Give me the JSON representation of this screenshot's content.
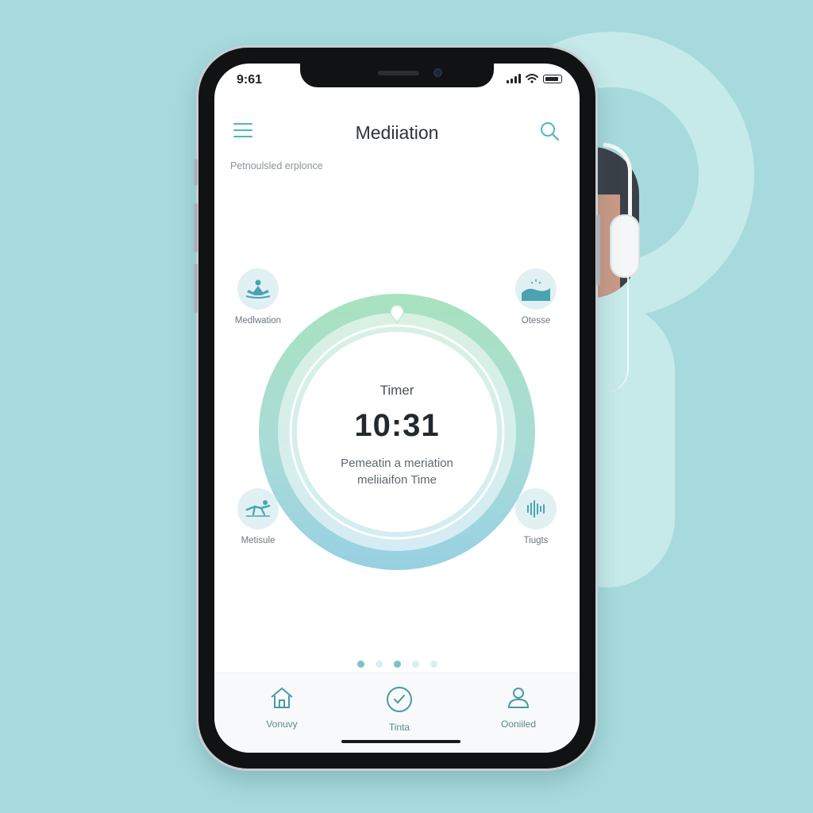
{
  "status_bar": {
    "time": "9:61"
  },
  "header": {
    "title": "Mediiation"
  },
  "subtitle": "Petnoulsled erplonce",
  "features": {
    "top_left": {
      "label": "Medlwation",
      "icon": "meditation-lotus-icon"
    },
    "top_right": {
      "label": "Otesse",
      "icon": "ocean-wave-icon"
    },
    "bottom_left": {
      "label": "Metisule",
      "icon": "stretch-pose-icon"
    },
    "bottom_right": {
      "label": "Tiugts",
      "icon": "sound-wave-icon"
    }
  },
  "timer": {
    "label": "Timer",
    "value": "10:31",
    "desc_line1": "Pemeatin a meriation",
    "desc_line2": "meliiaifon Time"
  },
  "pager": {
    "count": 5,
    "active": [
      0,
      2
    ]
  },
  "tabbar": {
    "tabs": [
      {
        "label": "Vonuvy",
        "icon": "home-icon"
      },
      {
        "label": "Tinta",
        "icon": "clock-icon"
      },
      {
        "label": "Ooniiled",
        "icon": "user-icon"
      }
    ]
  },
  "colors": {
    "background": "#a6dadc",
    "accent": "#4bb8b8",
    "ring_green": "#a8e2bf",
    "ring_blue": "#97d0e3"
  }
}
